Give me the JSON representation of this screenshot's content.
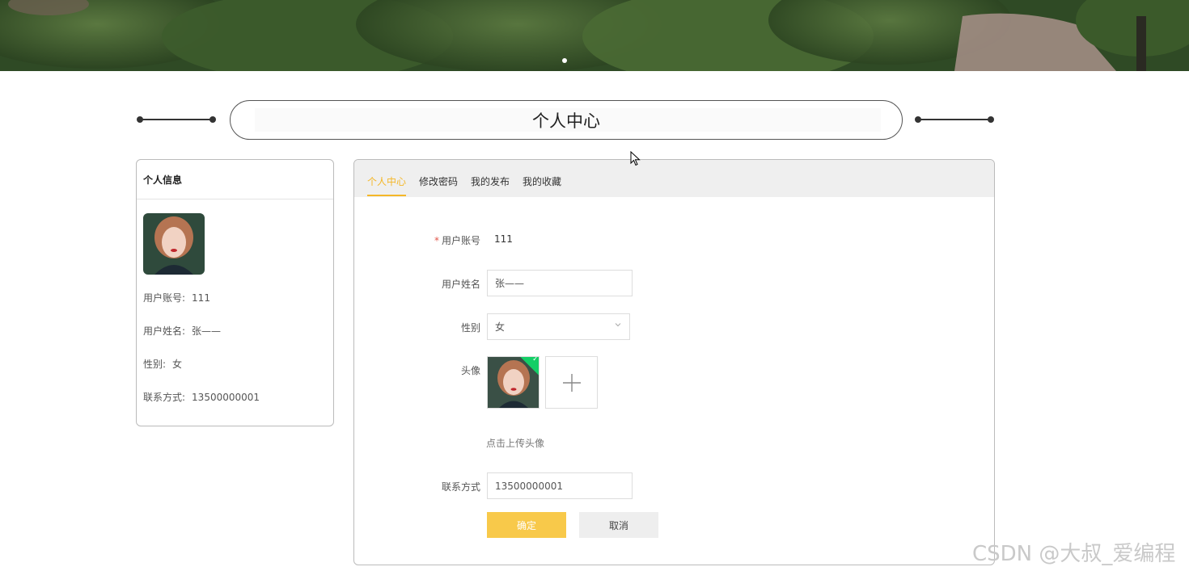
{
  "page": {
    "title": "个人中心",
    "watermark": "CSDN @大叔_爱编程"
  },
  "left_panel": {
    "header": "个人信息",
    "rows": [
      {
        "label": "用户账号:",
        "value": "111"
      },
      {
        "label": "用户姓名:",
        "value": "张——"
      },
      {
        "label": "性别:",
        "value": "女"
      },
      {
        "label": "联系方式:",
        "value": "13500000001"
      }
    ]
  },
  "tabs": [
    {
      "label": "个人中心",
      "active": true
    },
    {
      "label": "修改密码",
      "active": false
    },
    {
      "label": "我的发布",
      "active": false
    },
    {
      "label": "我的收藏",
      "active": false
    }
  ],
  "form": {
    "account": {
      "label": "用户账号",
      "value": "111",
      "required": true
    },
    "name": {
      "label": "用户姓名",
      "value": "张——"
    },
    "gender": {
      "label": "性别",
      "value": "女"
    },
    "avatar": {
      "label": "头像",
      "hint": "点击上传头像"
    },
    "contact": {
      "label": "联系方式",
      "value": "13500000001"
    },
    "confirm_label": "确定",
    "cancel_label": "取消"
  },
  "colors": {
    "accent": "#f4b728",
    "confirm_bg": "#f8c94a",
    "success": "#13ce66"
  },
  "icons": {
    "upload_success": "check-icon",
    "upload_add": "plus-icon",
    "select_arrow": "chevron-down-icon"
  }
}
